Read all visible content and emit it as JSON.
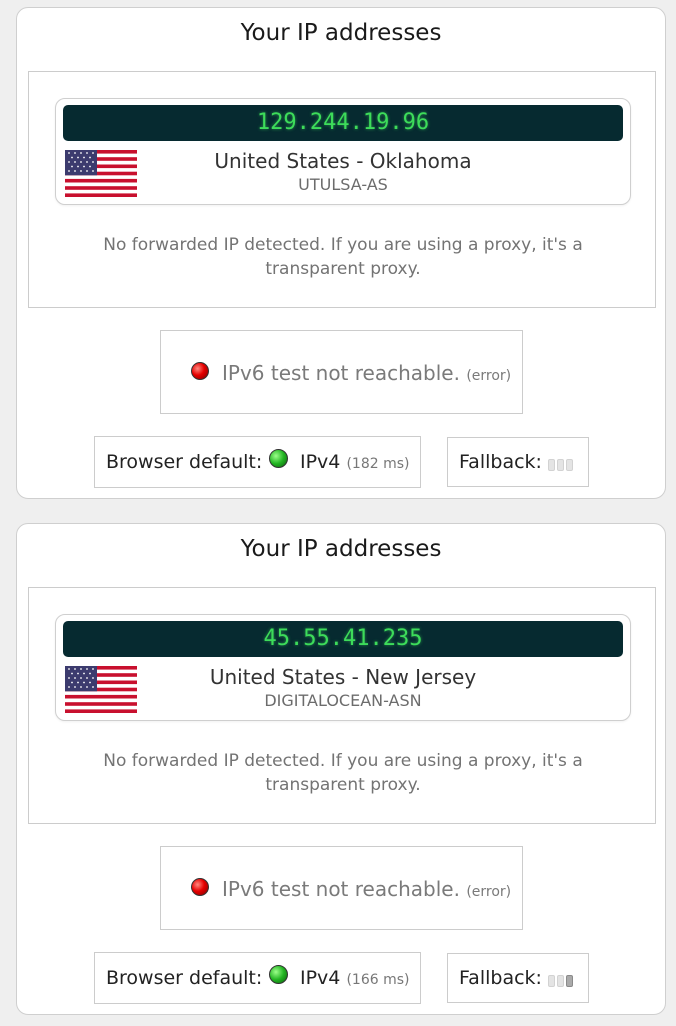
{
  "cards": [
    {
      "title": "Your IP addresses",
      "ip": "129.244.19.96",
      "location": "United States - Oklahoma",
      "asn": "UTULSA-AS",
      "forward_note": "No forwarded IP detected. If you are using a proxy, it's a transparent proxy.",
      "ipv6_status": "IPv6 test not reachable.",
      "ipv6_error": "(error)",
      "browser_default_label": "Browser default:",
      "protocol": "IPv4",
      "latency": "(182 ms)",
      "fallback_label": "Fallback:",
      "fallback_bars_active": 0
    },
    {
      "title": "Your IP addresses",
      "ip": "45.55.41.235",
      "location": "United States - New Jersey",
      "asn": "DIGITALOCEAN-ASN",
      "forward_note": "No forwarded IP detected. If you are using a proxy, it's a transparent proxy.",
      "ipv6_status": "IPv6 test not reachable.",
      "ipv6_error": "(error)",
      "browser_default_label": "Browser default:",
      "protocol": "IPv4",
      "latency": "(166 ms)",
      "fallback_label": "Fallback:",
      "fallback_bars_active": 1
    }
  ],
  "icons": {
    "flag": "us-flag-icon",
    "ipv6_indicator": "red-status-dot",
    "ipv4_indicator": "green-status-dot"
  },
  "colors": {
    "ip_bar_bg": "#062a30",
    "ip_text": "#3ddc5a",
    "error_dot": "#e60000",
    "ok_dot": "#22b422"
  }
}
